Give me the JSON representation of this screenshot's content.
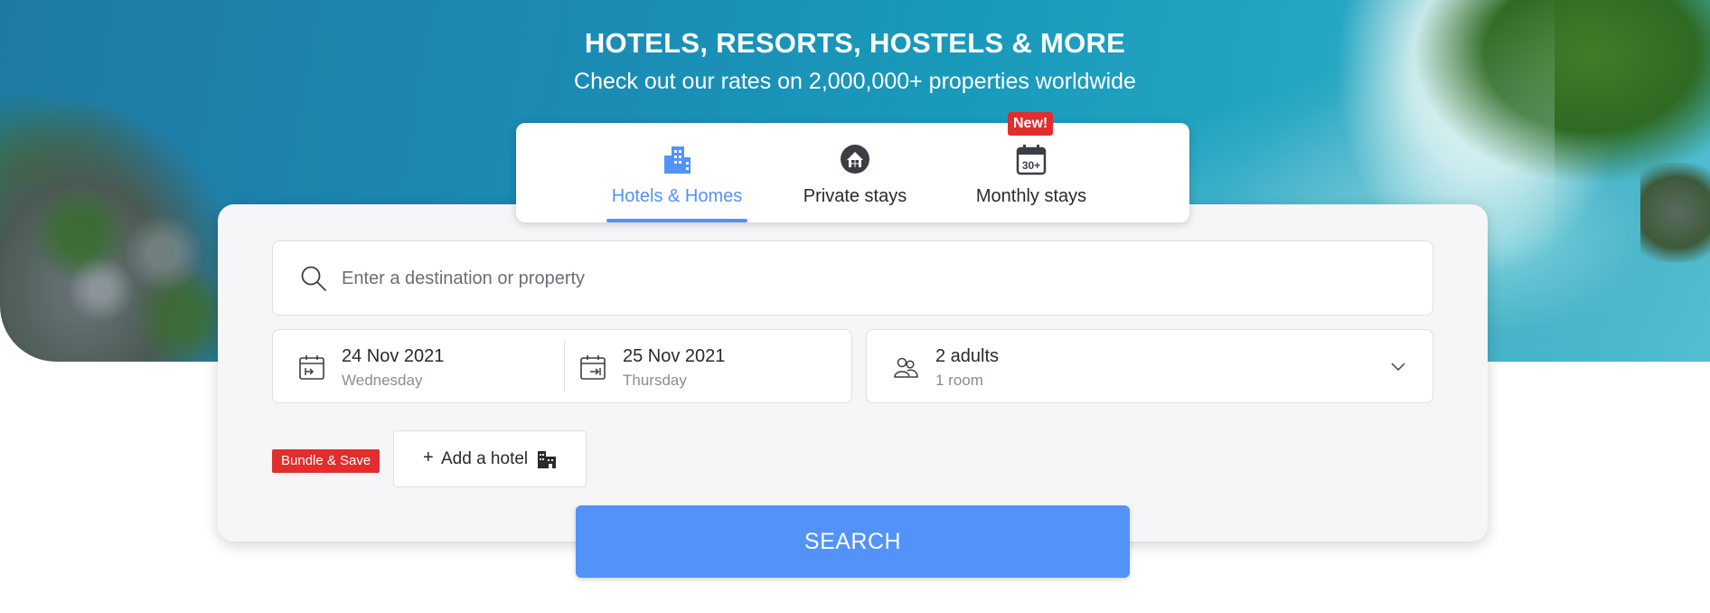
{
  "hero": {
    "headline": "HOTELS, RESORTS, HOSTELS & MORE",
    "subline": "Check out our rates on 2,000,000+ properties worldwide"
  },
  "tabs": {
    "items": [
      {
        "label": "Hotels & Homes",
        "icon": "building-icon",
        "active": true
      },
      {
        "label": "Private stays",
        "icon": "house-icon",
        "active": false
      },
      {
        "label": "Monthly stays",
        "icon": "calendar-30-icon",
        "active": false
      }
    ],
    "new_badge": "New!"
  },
  "search": {
    "placeholder": "Enter a destination or property",
    "value": ""
  },
  "dates": {
    "check_in": {
      "date": "24 Nov 2021",
      "day": "Wednesday"
    },
    "check_out": {
      "date": "25 Nov 2021",
      "day": "Thursday"
    }
  },
  "occupancy": {
    "guests": "2 adults",
    "rooms": "1 room"
  },
  "bundle": {
    "badge": "Bundle & Save",
    "plus": "+",
    "add_label": "Add a hotel"
  },
  "search_button": "SEARCH",
  "colors": {
    "accent": "#5392f9",
    "badge_red": "#e12d2d",
    "card_bg": "#f6f6f8"
  }
}
